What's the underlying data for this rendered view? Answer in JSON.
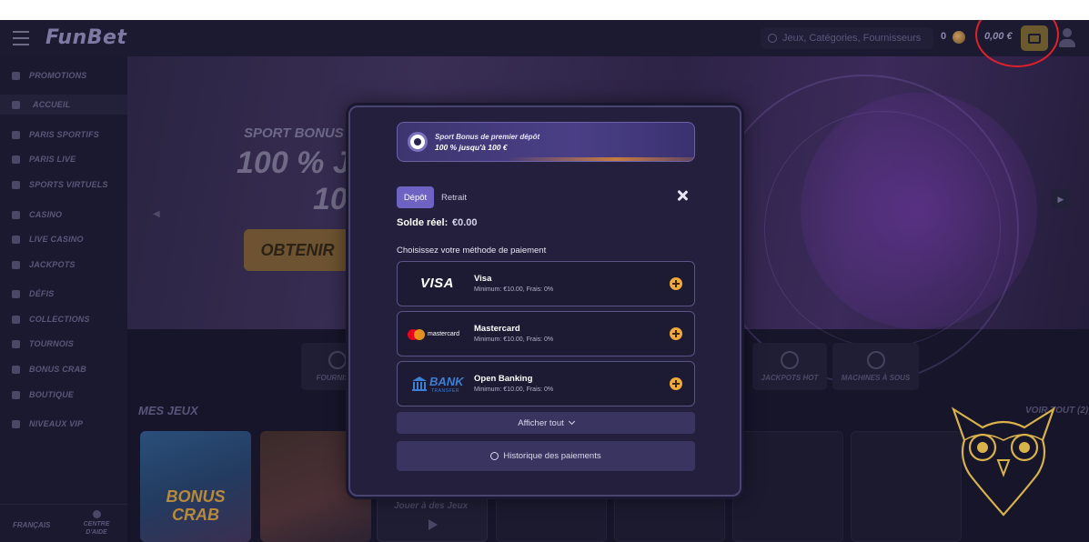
{
  "header": {
    "logo": "FunBet",
    "search_placeholder": "Jeux, Catégories, Fournisseurs",
    "coins": "0",
    "balance": "0,00 €"
  },
  "sidebar": {
    "items": [
      {
        "label": "PROMOTIONS"
      },
      {
        "label": "ACCUEIL"
      },
      {
        "label": "PARIS SPORTIFS"
      },
      {
        "label": "PARIS LIVE"
      },
      {
        "label": "SPORTS VIRTUELS"
      },
      {
        "label": "CASINO"
      },
      {
        "label": "LIVE CASINO"
      },
      {
        "label": "JACKPOTS"
      },
      {
        "label": "DÉFIS"
      },
      {
        "label": "COLLECTIONS"
      },
      {
        "label": "TOURNOIS"
      },
      {
        "label": "BONUS CRAB"
      },
      {
        "label": "BOUTIQUE"
      },
      {
        "label": "NIVEAUX VIP"
      }
    ],
    "language": "FRANÇAIS",
    "help_line1": "CENTRE",
    "help_line2": "D'AIDE"
  },
  "banner": {
    "line1": "SPORT BONUS I",
    "line2": "100 % J",
    "line3": "10",
    "cta": "OBTENIR"
  },
  "categories": {
    "left": "FOURNISSE",
    "jackpots": "JACKPOTS HOT",
    "machines": "MACHINES À SOUS"
  },
  "games": {
    "section_title": "MES JEUX",
    "see_all": "VOIR TOUT (2)",
    "bonus_crab_line1": "BONUS",
    "bonus_crab_line2": "CRAB",
    "play_label": "Jouer à des Jeux"
  },
  "modal": {
    "promo_line1": "Sport Bonus de premier dépôt",
    "promo_line2": "100 % jusqu'à 100 €",
    "tab_deposit": "Dépôt",
    "tab_withdraw": "Retrait",
    "balance_label": "Solde réel:",
    "balance_value": "€0.00",
    "choose_method": "Choisissez votre méthode de paiement",
    "methods": [
      {
        "logo": "VISA",
        "name": "Visa",
        "details": "Minimum: €10.00, Frais: 0%"
      },
      {
        "logo": "mastercard",
        "name": "Mastercard",
        "details": "Minimum: €10.00, Frais: 0%"
      },
      {
        "logo_line1": "BANK",
        "logo_line2": "TRANSFER",
        "name": "Open Banking",
        "details": "Minimum: €10.00, Frais: 0%"
      }
    ],
    "show_all": "Afficher tout",
    "history": "Historique des paiements"
  },
  "colors": {
    "accent": "#6e63c2",
    "plus_button": "#f0a93a",
    "highlight_circle": "#e0202a"
  }
}
